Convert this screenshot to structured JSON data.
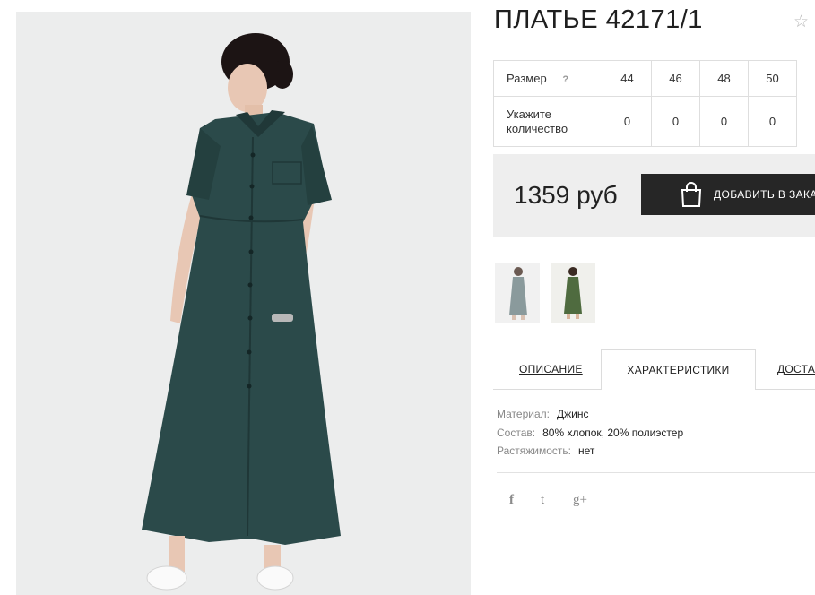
{
  "product": {
    "title": "ПЛАТЬЕ 42171/1",
    "favorite_icon": "star-outline-icon"
  },
  "sizes": {
    "size_label": "Размер",
    "help_label": "?",
    "qty_label_line1": "Укажите",
    "qty_label_line2": "количество",
    "columns": [
      {
        "size": "44",
        "qty": "0"
      },
      {
        "size": "46",
        "qty": "0"
      },
      {
        "size": "48",
        "qty": "0"
      },
      {
        "size": "50",
        "qty": "0"
      }
    ]
  },
  "price": {
    "value": "1359 руб",
    "order_button": "ДОБАВИТЬ В ЗАКАЗ",
    "order_icon": "shopping-bag-icon"
  },
  "tabs": {
    "description": "ОПИСАНИЕ",
    "characteristics": "ХАРАКТЕРИСТИКИ",
    "delivery": "ДОСТАВКА"
  },
  "specs": [
    {
      "key": "Материал:",
      "value": "Джинс"
    },
    {
      "key": "Состав:",
      "value": "80% хлопок, 20% полиэстер"
    },
    {
      "key": "Растяжимость:",
      "value": "нет"
    }
  ],
  "social": {
    "facebook": "f",
    "twitter": "t",
    "google_plus": "g+"
  },
  "colors": {
    "dress_main": "#2b4a4a",
    "dress_alt": "#4f6b3f",
    "button_dark": "#262626",
    "price_bg": "#eeeeee"
  }
}
